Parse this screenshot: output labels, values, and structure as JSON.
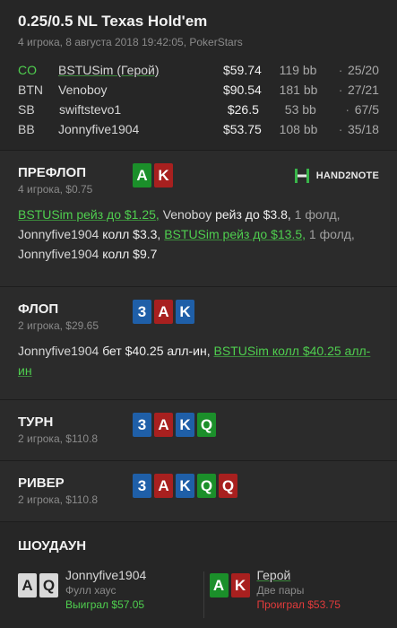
{
  "header": {
    "title": "0.25/0.5 NL Texas Hold'em",
    "subtitle": "4 игрока, 8 августа 2018 19:42:05, PokerStars"
  },
  "players": [
    {
      "pos": "CO",
      "name": "BSTUSim (Герой)",
      "stack": "$59.74",
      "bb": "119 bb",
      "pct": "25/20",
      "hero": true
    },
    {
      "pos": "BTN",
      "name": "Venoboy",
      "stack": "$90.54",
      "bb": "181 bb",
      "pct": "27/21",
      "hero": false
    },
    {
      "pos": "SB",
      "name": "swiftstevo1",
      "stack": "$26.5",
      "bb": "53 bb",
      "pct": "67/5",
      "hero": false
    },
    {
      "pos": "BB",
      "name": "Jonnyfive1904",
      "stack": "$53.75",
      "bb": "108 bb",
      "pct": "35/18",
      "hero": false
    }
  ],
  "dot": "·",
  "preflop": {
    "title": "ПРЕФЛОП",
    "meta": "4 игрока, $0.75",
    "cards": [
      "A",
      "K"
    ],
    "brand": "HAND2NOTE",
    "actions": {
      "a1": "BSTUSim рейз до $1.25,",
      "a2": "Venoboy",
      "a3": "рейз до $3.8,",
      "a4": "1 фолд,",
      "a5": "Jonnyfive1904",
      "a6": "колл $3.3,",
      "a7": "BSTUSim рейз до $13.5,",
      "a8": "1 фолд,",
      "a9": "Jonnyfive1904",
      "a10": "колл $9.7"
    }
  },
  "flop": {
    "title": "ФЛОП",
    "meta": "2 игрока, $29.65",
    "cards": [
      "3",
      "A",
      "K"
    ],
    "actions": {
      "a1": "Jonnyfive1904",
      "a2": "бет $40.25 алл-ин,",
      "a3": "BSTUSim колл $40.25 алл-ин"
    }
  },
  "turn": {
    "title": "ТУРН",
    "meta": "2 игрока, $110.8",
    "cards": [
      "3",
      "A",
      "K",
      "Q"
    ]
  },
  "river": {
    "title": "РИВЕР",
    "meta": "2 игрока, $110.8",
    "cards": [
      "3",
      "A",
      "K",
      "Q",
      "Q"
    ]
  },
  "showdown": {
    "title": "ШОУДАУН",
    "left": {
      "cards": [
        "A",
        "Q"
      ],
      "name": "Jonnyfive1904",
      "hand": "Фулл хаус",
      "result": "Выиграл $57.05"
    },
    "right": {
      "cards": [
        "A",
        "K"
      ],
      "name": "Герой",
      "hand": "Две пары",
      "result": "Проиграл $53.75"
    }
  },
  "colors": {
    "hero": "#4fcf4f",
    "lose": "#e33b3b",
    "spade": "#d9d9d9",
    "heart": "#a8201f",
    "club": "#1b8f2a",
    "diamond": "#1f5fa8"
  }
}
